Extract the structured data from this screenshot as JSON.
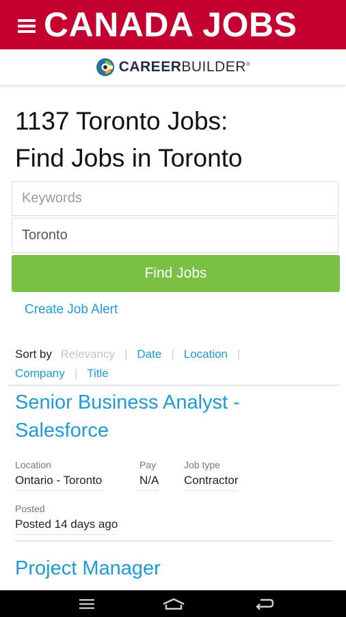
{
  "app": {
    "title": "CANADA JOBS"
  },
  "logo": {
    "text_bold": "CAREER",
    "text_light": "BUILDER",
    "tm": "®"
  },
  "page": {
    "title_line1": "1137 Toronto Jobs:",
    "title_line2": "Find Jobs in Toronto"
  },
  "search": {
    "keywords_placeholder": "Keywords",
    "location_value": "Toronto",
    "find_button": "Find Jobs"
  },
  "create_alert": "Create Job Alert",
  "sort": {
    "label": "Sort by",
    "options": [
      "Relevancy",
      "Date",
      "Location",
      "Company",
      "Title"
    ],
    "separator": "|"
  },
  "jobs": [
    {
      "title_line1": "Senior Business Analyst -",
      "title_line2": "Salesforce",
      "location_label": "Location",
      "location": "Ontario - Toronto",
      "pay_label": "Pay",
      "pay": "N/A",
      "type_label": "Job type",
      "type": "Contractor",
      "posted_label": "Posted",
      "posted": "Posted 14 days ago"
    },
    {
      "title_line1": "Project Manager"
    }
  ],
  "colors": {
    "brand_red": "#c3002f",
    "accent_blue": "#1e9ad6",
    "button_green": "#7ac143"
  },
  "icons": {
    "menu": "hamburger-menu-icon",
    "logo": "careerbuilder-logo-icon",
    "nav_recent": "recent-apps-icon",
    "nav_home": "home-icon",
    "nav_back": "back-icon"
  }
}
